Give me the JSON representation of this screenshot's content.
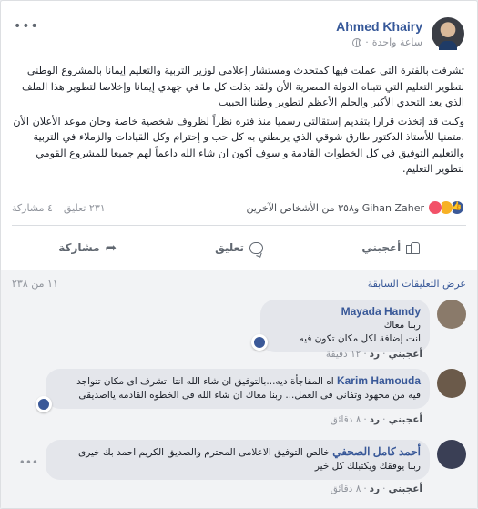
{
  "post": {
    "author": "Ahmed Khairy",
    "timestamp": "ساعة واحدة",
    "menu_icon": "more-dots-icon",
    "paragraphs": [
      "تشرفت بالفترة التي عملت فيها كمتحدث ومستشار إعلامي لوزير التربية والتعليم إيمانا بالمشروع الوطني لتطوير التعليم التي تتبناه الدولة المصرية الأن ولقد بذلت كل ما في جهدي إيمانا وإخلاصا لتطوير هذا الملف الذي يعد التحدي الأكبر والحلم الأعظم لتطوير وطننا الحبيب",
      "وكنت قد إتخذت قرارا بتقديم إستقالتي رسميا منذ فتره نظراً لظروف شخصية خاصة وحان موعد الأعلان الأن .متمنيا للأستاذ الدكتور طارق شوقي الذي يربطني به كل حب و إحترام وكل القيادات والزملاء في التربية والتعليم التوفيق في كل الخطوات القادمة و سوف أكون ان شاء الله داعماً لهم جميعا للمشروع القومي لتطوير التعليم."
    ]
  },
  "reactions": {
    "names": "Gihan Zaher و٣٥٨ من الأشخاص الآخرين",
    "comments_count": "٢٣١ تعليق",
    "shares_count": "٤ مشاركة"
  },
  "actions": {
    "like": "أعجبني",
    "comment": "تعليق",
    "share": "مشاركة"
  },
  "comments_section": {
    "previous_link": "عرض التعليقات السابقة",
    "count": "١١ من ٢٣٨",
    "like_label": "أعجبني",
    "reply_label": "رد",
    "items": [
      {
        "name": "Mayada Hamdy",
        "text": "ربنا معاك",
        "text2": "انت إضافة لكل مكان تكون فيه",
        "time": "١٢ دقيقة",
        "avatar_color": "#8a7a6a"
      },
      {
        "name": "Karim Hamouda",
        "text": "اه المفاجأة ديه...بالتوفيق ان شاء الله انتا اتشرف اى مكان تتواجد",
        "text2": "فيه من مجهود وتفانى فى العمل... ربنا معاك ان شاء الله فى الخطوه القادمه يااصديقى",
        "time": "٨ دقائق",
        "avatar_color": "#6b5a4a"
      },
      {
        "name": "أحمد كامل الصحفي",
        "text": "خالص التوفيق الاعلامى المحترم والصديق الكريم احمد بك خيرى",
        "text2": "ربنا يوفقك ويكتبلك كل خير",
        "time": "٨ دقائق",
        "avatar_color": "#3a3f55"
      }
    ]
  }
}
